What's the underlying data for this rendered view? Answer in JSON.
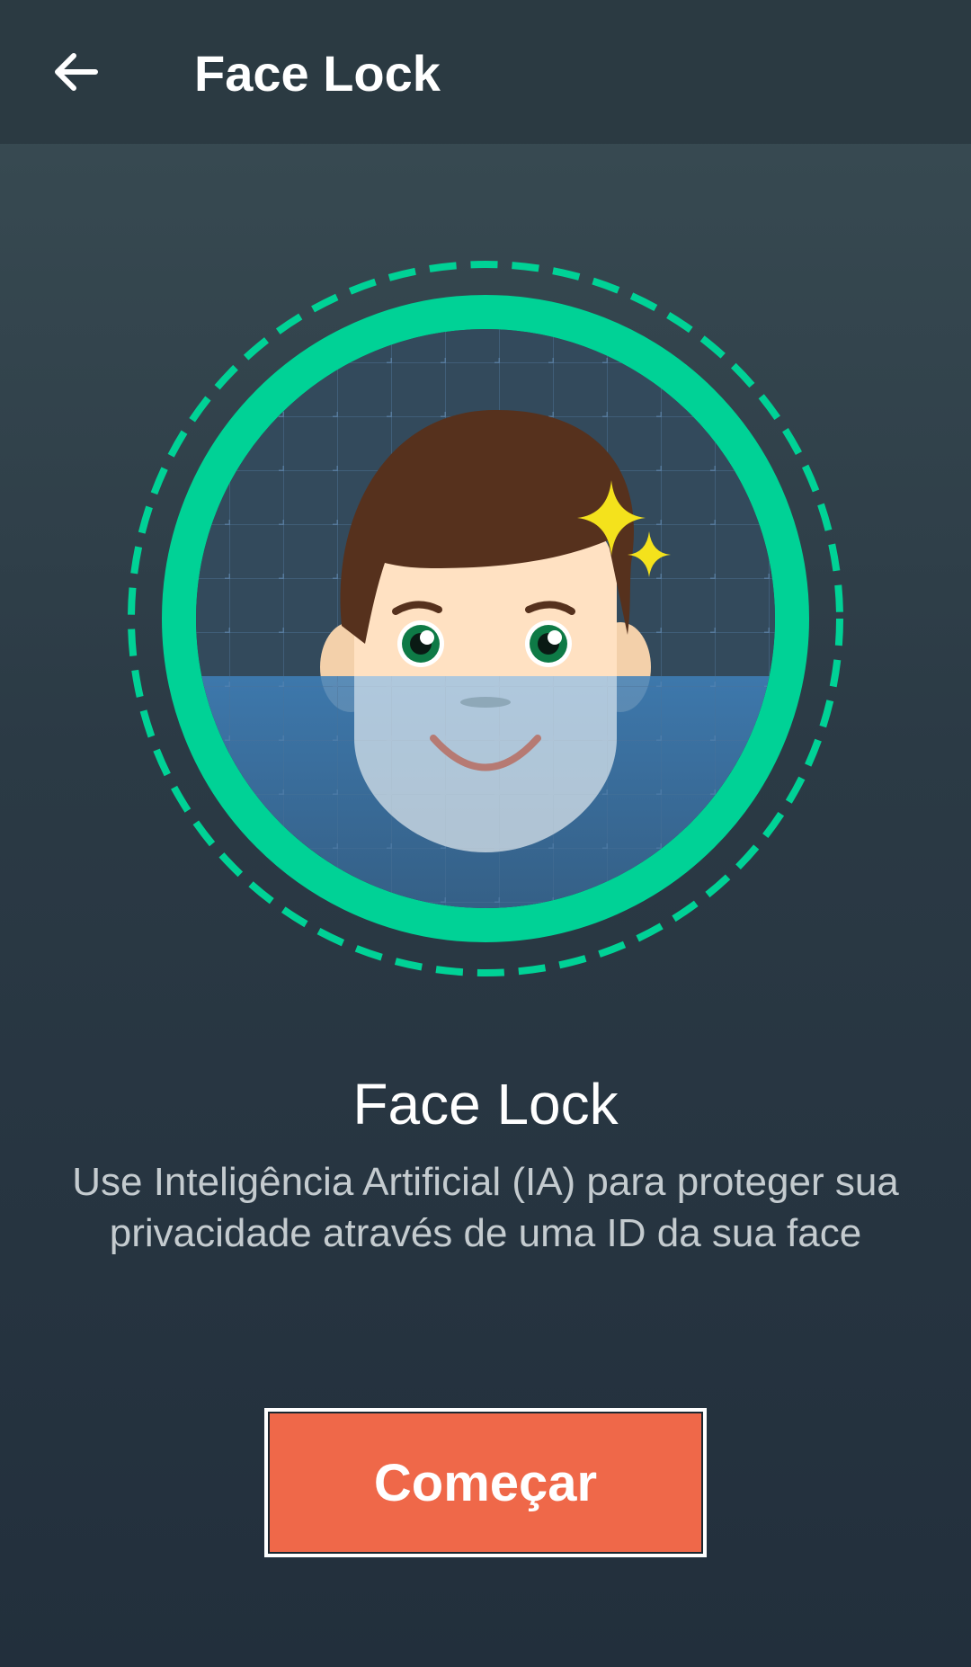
{
  "app_bar": {
    "back_icon": "arrow-left-icon",
    "title": "Face Lock"
  },
  "illustration": {
    "description_icon": "face-scan-icon",
    "accent_color": "#00d296",
    "sparkle_color": "#f4e21c"
  },
  "content": {
    "headline": "Face Lock",
    "description": "Use Inteligência Artificial (IA) para proteger sua privacidade através de uma ID da sua face"
  },
  "actions": {
    "start_label": "Começar",
    "start_color": "#ef6849"
  }
}
